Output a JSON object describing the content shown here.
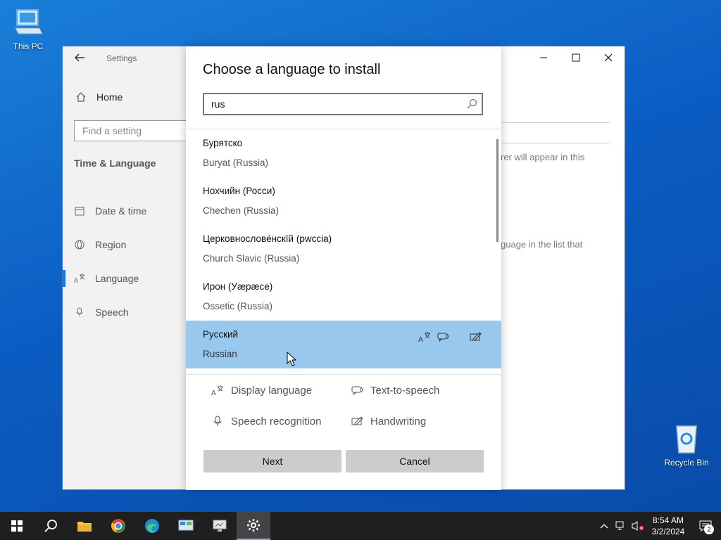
{
  "desktop": {
    "icons": [
      {
        "label": "This PC"
      },
      {
        "label": "Recycle Bin"
      }
    ]
  },
  "settings": {
    "app_title": "Settings",
    "home_label": "Home",
    "find_placeholder": "Find a setting",
    "section_title": "Time & Language",
    "nav": [
      {
        "label": "Date & time",
        "icon": "calendar-icon"
      },
      {
        "label": "Region",
        "icon": "globe-icon"
      },
      {
        "label": "Language",
        "icon": "language-icon",
        "active": true
      },
      {
        "label": "Speech",
        "icon": "microphone-icon"
      }
    ],
    "bg_text_1": "rer will appear in this",
    "bg_text_2": "guage in the list that"
  },
  "dialog": {
    "title": "Choose a language to install",
    "search_value": "rus",
    "languages": [
      {
        "native": "Бурятско",
        "english": "Buryat (Russia)"
      },
      {
        "native": "Нохчийн (Росси)",
        "english": "Chechen (Russia)"
      },
      {
        "native": "Церковнословéнскїй (рwссіа)",
        "english": "Church Slavic (Russia)"
      },
      {
        "native": "Ирон (Уæрæсе)",
        "english": "Ossetic (Russia)"
      },
      {
        "native": "Русский",
        "english": "Russian",
        "selected": true
      }
    ],
    "legend": {
      "display_language": "Display language",
      "text_to_speech": "Text-to-speech",
      "speech_recognition": "Speech recognition",
      "handwriting": "Handwriting"
    },
    "next_label": "Next",
    "cancel_label": "Cancel"
  },
  "taskbar": {
    "time": "8:54 AM",
    "date": "3/2/2024",
    "notification_count": "2"
  },
  "colors": {
    "selected_row": "#99c8ef",
    "accent": "#1a73d6",
    "taskbar": "#1f1f1f"
  }
}
